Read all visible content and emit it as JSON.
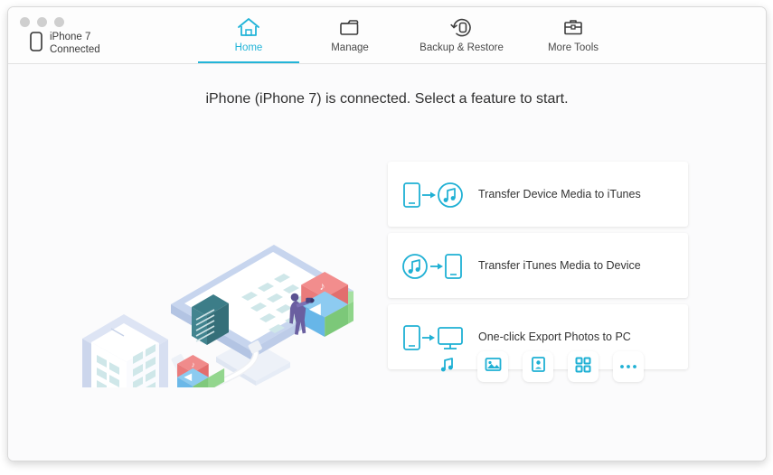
{
  "window": {
    "traffic_lights": [
      "close",
      "minimize",
      "maximize"
    ]
  },
  "header": {
    "device_name": "iPhone 7",
    "device_status": "Connected",
    "device_icon": "phone-icon",
    "tabs": [
      {
        "label": "Home",
        "icon": "home-icon",
        "active": true
      },
      {
        "label": "Manage",
        "icon": "folder-icon",
        "active": false
      },
      {
        "label": "Backup & Restore",
        "icon": "backup-restore-icon",
        "active": false
      },
      {
        "label": "More Tools",
        "icon": "toolbox-icon",
        "active": false
      }
    ]
  },
  "main": {
    "headline": "iPhone (iPhone 7)  is connected. Select a feature to start.",
    "illustration": {
      "name": "device-to-computer-transfer-illustration",
      "elements": [
        "smartphone",
        "desktop-monitor",
        "usb-cable",
        "media-cubes",
        "person-figure"
      ]
    },
    "feature_cards": [
      {
        "label": "Transfer Device Media to iTunes",
        "icon_left": "phone-icon",
        "icon_right": "itunes-music-circle-icon"
      },
      {
        "label": "Transfer iTunes Media to Device",
        "icon_left": "itunes-music-circle-icon",
        "icon_right": "phone-icon"
      },
      {
        "label": "One-click Export Photos to PC",
        "icon_left": "phone-icon",
        "icon_right": "monitor-icon"
      }
    ],
    "quick_icons": [
      {
        "name": "music-icon",
        "boxed": false
      },
      {
        "name": "photos-icon",
        "boxed": true
      },
      {
        "name": "contacts-icon",
        "boxed": true
      },
      {
        "name": "apps-grid-icon",
        "boxed": true
      },
      {
        "name": "more-icon",
        "boxed": true
      }
    ]
  },
  "colors": {
    "accent": "#22b4d8",
    "card_icon": "#1fb0d4",
    "text": "#333333",
    "background": "#fbfbfc"
  }
}
